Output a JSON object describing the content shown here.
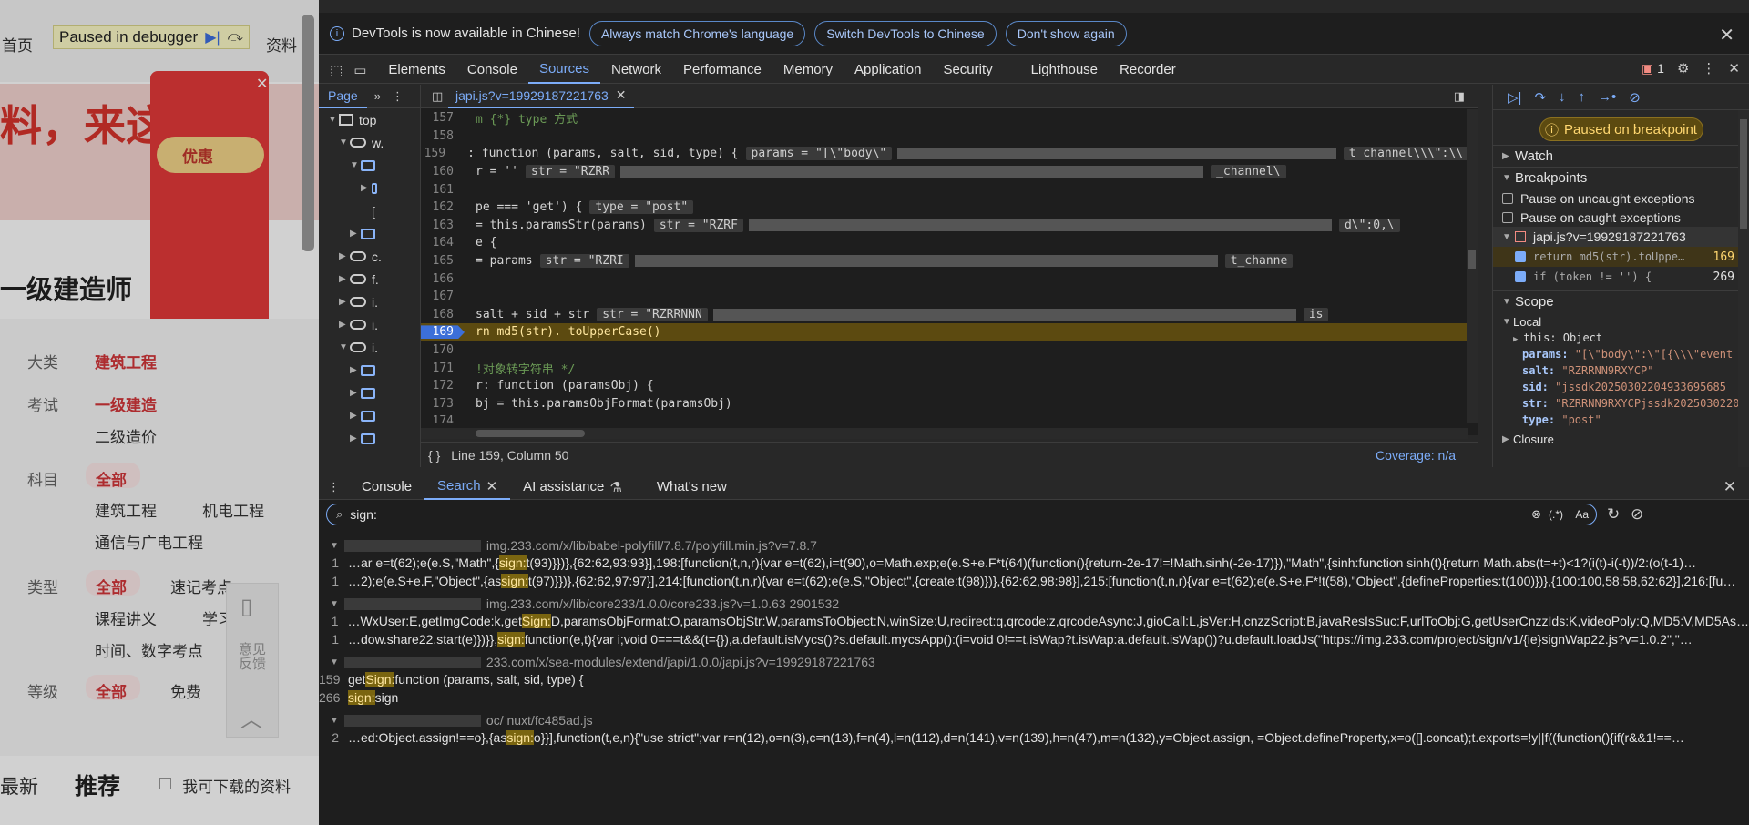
{
  "page": {
    "home": "首页",
    "resources": "资料",
    "debugger_label": "Paused in debugger",
    "slogan": "料，来这",
    "promo": "优惠",
    "heading": "一级建造师",
    "filters": [
      {
        "label": "大类",
        "selected": "建筑工程",
        "options": []
      },
      {
        "label": "考试",
        "selected": "一级建造",
        "options": [
          "二级造价"
        ]
      },
      {
        "label": "科目",
        "selected": "全部",
        "options": [
          "建筑工程",
          "机电工程",
          "通信与广电工程"
        ]
      },
      {
        "label": "类型",
        "selected": "全部",
        "options": [
          "速记考点",
          "课程讲义",
          "学习",
          "时间、数字考点"
        ]
      },
      {
        "label": "等级",
        "selected": "全部",
        "options": [
          "免费"
        ]
      }
    ],
    "latest": "最新",
    "recommend": "推荐",
    "downloadable": "我可下载的资料",
    "feedback": "意见反馈"
  },
  "infobar": {
    "message": "DevTools is now available in Chinese!",
    "btn_match": "Always match Chrome's language",
    "btn_switch": "Switch DevTools to Chinese",
    "btn_dont": "Don't show again"
  },
  "tabs": [
    "Elements",
    "Console",
    "Sources",
    "Network",
    "Performance",
    "Memory",
    "Application",
    "Security",
    "Lighthouse",
    "Recorder"
  ],
  "issues_count": "1",
  "nav": {
    "page_tab": "Page",
    "top": "top",
    "items": [
      "w.",
      "c.",
      "f.",
      "i.",
      "i.",
      "i."
    ]
  },
  "editor": {
    "file_tab": "japi.js?v=19929187221763",
    "status_pos": "Line 159, Column 50",
    "coverage": "Coverage: n/a",
    "lines": [
      {
        "n": "157",
        "code": "m {*} type 方式",
        "cls": "cm",
        "inline": ""
      },
      {
        "n": "158",
        "code": "",
        "cls": "",
        "inline": ""
      },
      {
        "n": "159",
        "code": ": function (params, salt, sid, type) {",
        "cls": "",
        "inline": "params = \"[\\\"body\\\"",
        "tail": "t channel\\\\\\\":\\\\"
      },
      {
        "n": "160",
        "code": "r = ''",
        "cls": "",
        "inline": "str = \"RZRR",
        "tail": "_channel\\"
      },
      {
        "n": "161",
        "code": "",
        "cls": "",
        "inline": ""
      },
      {
        "n": "162",
        "code": "pe === 'get') {",
        "cls": "",
        "inline": "type = \"post\""
      },
      {
        "n": "163",
        "code": "= this.paramsStr(params)",
        "cls": "",
        "inline": "str = \"RZRF",
        "tail": "d\\\":0,\\"
      },
      {
        "n": "164",
        "code": "e {",
        "cls": "",
        "inline": ""
      },
      {
        "n": "165",
        "code": "= params",
        "cls": "",
        "inline": "str = \"RZRI",
        "tail": "t_channe"
      },
      {
        "n": "166",
        "code": "",
        "cls": "",
        "inline": ""
      },
      {
        "n": "167",
        "code": "",
        "cls": "",
        "inline": ""
      },
      {
        "n": "168",
        "code": "salt + sid + str",
        "cls": "",
        "inline": "str = \"RZRRNNN",
        "tail": "is"
      },
      {
        "n": "169",
        "code": "rn  md5(str). toUpperCase()",
        "cls": "bp",
        "inline": ""
      },
      {
        "n": "170",
        "code": "",
        "cls": "",
        "inline": ""
      },
      {
        "n": "171",
        "code": "!对象转字符串 */",
        "cls": "cm",
        "inline": ""
      },
      {
        "n": "172",
        "code": "r: function (paramsObj) {",
        "cls": "",
        "inline": ""
      },
      {
        "n": "173",
        "code": "bj = this.paramsObjFormat(paramsObj)",
        "cls": "",
        "inline": ""
      },
      {
        "n": "174",
        "code": "",
        "cls": "",
        "inline": ""
      }
    ]
  },
  "debugger": {
    "paused": "Paused on breakpoint",
    "watch": "Watch",
    "breakpoints": "Breakpoints",
    "pause_uncaught": "Pause on uncaught exceptions",
    "pause_caught": "Pause on caught exceptions",
    "bp_file": "japi.js?v=19929187221763",
    "bp1_code": "return md5(str).toUppe…",
    "bp1_line": "169",
    "bp2_code": "if (token != '') {",
    "bp2_line": "269",
    "scope": "Scope",
    "local": "Local",
    "this_val": "this: Object",
    "vars": [
      {
        "k": "params:",
        "v": "\"[\\\"body\\\":\\\"[{\\\\\\\"event"
      },
      {
        "k": "salt:",
        "v": "\"RZRRNN9RXYCP\""
      },
      {
        "k": "sid:",
        "v": "\"jssdk20250302204933695685"
      },
      {
        "k": "str:",
        "v": "\"RZRRNN9RXYCPjssdk2025030220"
      },
      {
        "k": "type:",
        "v": "\"post\""
      }
    ],
    "closure": "Closure"
  },
  "drawer": {
    "tabs": [
      "Console",
      "Search",
      "AI assistance",
      "What's new"
    ],
    "search_value": "sign:",
    "results": [
      {
        "file": "img.233.com/x/lib/babel-polyfill/7.8.7/polyfill.min.js?v=7.8.7",
        "lines": [
          {
            "n": "1",
            "pre": "…ar e=t(62);e(e.S,\"Math\",{",
            "m": "sign:",
            "post": "t(93)}})},{62:62,93:93}],198:[function(t,n,r){var e=t(62),i=t(90),o=Math.exp;e(e.S+e.F*t(64)(function(){return-2e-17!=!Math.sinh(-2e-17)}),\"Math\",{sinh:function sinh(t){return Math.abs(t=+t)<1?(i(t)-i(-t))/2:(o(t-1)…"
          },
          {
            "n": "1",
            "pre": "…2);e(e.S+e.F,\"Object\",{as",
            "m": "sign:",
            "post": "t(97)}})},{62:62,97:97}],214:[function(t,n,r){var e=t(62);e(e.S,\"Object\",{create:t(98)})},{62:62,98:98}],215:[function(t,n,r){var e=t(62);e(e.S+e.F*!t(58),\"Object\",{defineProperties:t(100)})},{100:100,58:58,62:62}],216:[fu…"
          }
        ]
      },
      {
        "file": "img.233.com/x/lib/core233/1.0.0/core233.js?v=1.0.63 2901532",
        "lines": [
          {
            "n": "1",
            "pre": "…WxUser:E,getImgCode:k,get",
            "m": "Sign:",
            "post": "D,paramsObjFormat:O,paramsObjStr:W,paramsToObject:N,winSize:U,redirect:q,qrcode:z,qrcodeAsync:J,gioCall:L,jsVer:H,cnzzScript:B,javaResIsSuc:F,urlToObj:G,getUserCnzzIds:K,videoPoly:Q,MD5:V,MD5As…"
          },
          {
            "n": "1",
            "pre": "…dow.share22.start(e)})}},",
            "m": "sign:",
            "post": "function(e,t){var i;void 0===t&&(t={}),a.default.isMycs()?s.default.mycsApp():(i=void 0!==t.isWap?t.isWap:a.default.isWap())?u.default.loadJs(\"https://img.233.com/project/sign/v1/{ie}signWap22.js?v=1.0.2\",\"…"
          }
        ]
      },
      {
        "file": "233.com/x/sea-modules/extend/japi/1.0.0/japi.js?v=19929187221763",
        "lines": [
          {
            "n": "159",
            "pre": "get",
            "m": "Sign:",
            "post": " function (params, salt, sid, type) {"
          },
          {
            "n": "266",
            "pre": "",
            "m": "sign:",
            "post": " sign"
          }
        ]
      },
      {
        "file": "oc/ nuxt/fc485ad.js",
        "lines": [
          {
            "n": "2",
            "pre": "…ed:Object.assign!==o},{as",
            "m": "sign:",
            "post": "o}}],function(t,e,n){\"use strict\";var r=n(12),o=n(3),c=n(13),f=n(4),l=n(112),d=n(141),v=n(139),h=n(47),m=n(132),y=Object.assign, =Object.defineProperty,x=o([].concat);t.exports=!y||f((function(){if(r&&1!==…"
          }
        ]
      }
    ]
  }
}
